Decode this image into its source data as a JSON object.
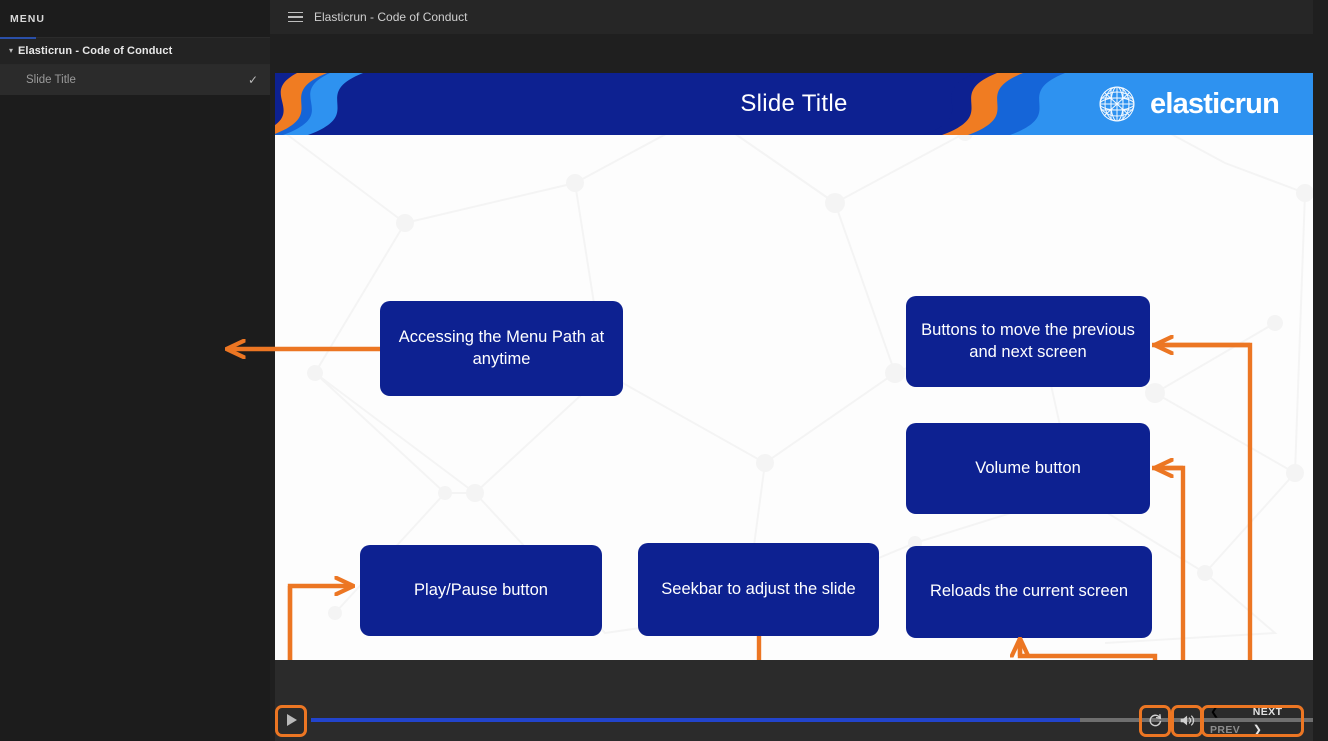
{
  "sidebar": {
    "menu_label": "MENU",
    "group": {
      "title": "Elasticrun - Code of Conduct",
      "caret": "▾"
    },
    "items": [
      {
        "label": "Slide Title",
        "check": "✓"
      }
    ]
  },
  "topbar": {
    "menu_icon": "hamburger-icon",
    "title": "Elasticrun - Code of Conduct"
  },
  "slide": {
    "title": "Slide Title",
    "brand": "elasticrun",
    "brand_icon": "globe-wireframe-icon",
    "header_bg": "#0d2191",
    "header_accent_orange": "#f07c22",
    "header_accent_lightblue": "#2e92f0"
  },
  "callouts": [
    {
      "id": "menu-path",
      "text": "Accessing the Menu Path at anytime"
    },
    {
      "id": "nav-buttons",
      "text": "Buttons to move the previous and next screen"
    },
    {
      "id": "volume",
      "text": "Volume button"
    },
    {
      "id": "play-pause",
      "text": "Play/Pause button"
    },
    {
      "id": "seekbar",
      "text": "Seekbar to adjust the slide"
    },
    {
      "id": "reload",
      "text": "Reloads the current screen"
    }
  ],
  "player": {
    "play_icon": "play-icon",
    "reload_icon": "reload-icon",
    "volume_icon": "volume-icon",
    "prev_label": "PREV",
    "next_label": "NEXT",
    "prev_chevron": "❮",
    "next_chevron": "❯",
    "progress_percent": 70,
    "progress_color": "#2244cc",
    "track_color": "#6f6f6f",
    "highlight_color": "#ec7623"
  },
  "colors": {
    "accent_orange": "#ec7623",
    "callout_blue": "#0d2191",
    "sidebar_bg": "#1c1c1c",
    "stage_bg": "#fdfdfd"
  }
}
